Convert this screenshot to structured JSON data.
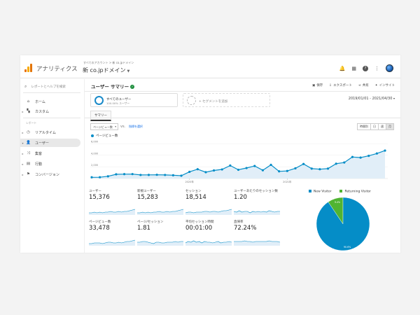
{
  "app": {
    "name": "アナリティクス"
  },
  "header": {
    "breadcrumb": "すべてのアカウント > 新 co.jpドメイン",
    "property": "新 co.jpドメイン",
    "icons": [
      "bell-icon",
      "apps-icon",
      "help-icon",
      "more-icon"
    ]
  },
  "sidebar": {
    "search_placeholder": "レポートとヘルプを検索",
    "items_top": [
      {
        "label": "ホーム",
        "icon": "home-icon"
      },
      {
        "label": "カスタム",
        "icon": "grid-icon"
      }
    ],
    "section_label": "レポート",
    "items": [
      {
        "label": "リアルタイム",
        "icon": "clock-icon",
        "active": false
      },
      {
        "label": "ユーザー",
        "icon": "person-icon",
        "active": true
      },
      {
        "label": "集客",
        "icon": "acquisition-icon",
        "active": false
      },
      {
        "label": "行動",
        "icon": "behavior-icon",
        "active": false
      },
      {
        "label": "コンバージョン",
        "icon": "flag-icon",
        "active": false
      }
    ]
  },
  "page": {
    "title": "ユーザー サマリー",
    "actions": {
      "save": "保存",
      "export": "エクスポート",
      "share": "共有",
      "insight": "インサイト"
    },
    "segments": {
      "all_users": "すべてのユーザー",
      "all_users_sub": "100.00% ユーザー",
      "add_segment": "+ セグメントを追加"
    },
    "date_range": "2019/01/01 - 2021/04/30",
    "tab": "サマリー",
    "metric_select": "ページビュー数",
    "vs": "vs.",
    "compare_label": "指標を選択",
    "period_buttons": [
      "時間別",
      "日",
      "週",
      "月"
    ],
    "period_selected": "月"
  },
  "chart_data": {
    "type": "line",
    "series": [
      {
        "name": "ページビュー数",
        "values": [
          210,
          220,
          380,
          720,
          750,
          760,
          610,
          620,
          640,
          610,
          560,
          480,
          1150,
          1600,
          1080,
          1380,
          1560,
          2230,
          1500,
          1800,
          2150,
          1420,
          2350,
          1230,
          1300,
          1750,
          2500,
          1700,
          1600,
          1700,
          2550,
          2750,
          3700,
          3600,
          3900,
          4300,
          4800
        ]
      }
    ],
    "x_labels": [
      "2020年",
      "2021年"
    ],
    "y_ticks": [
      "2,000",
      "4,000",
      "6,000"
    ],
    "ylim": [
      0,
      6500
    ],
    "color": "#058dc7",
    "fill": "#e1eef8"
  },
  "metrics": [
    {
      "label": "ユーザー",
      "value": "15,376",
      "spark": [
        3,
        3,
        4,
        3,
        4,
        3,
        4,
        4,
        5,
        4,
        4,
        5,
        4,
        5,
        5,
        6,
        7,
        8
      ]
    },
    {
      "label": "新規ユーザー",
      "value": "15,283",
      "spark": [
        3,
        3,
        4,
        3,
        4,
        3,
        4,
        4,
        5,
        4,
        4,
        5,
        4,
        5,
        5,
        6,
        7,
        8
      ]
    },
    {
      "label": "セッション",
      "value": "18,514",
      "spark": [
        3,
        4,
        4,
        3,
        4,
        4,
        4,
        5,
        5,
        4,
        5,
        5,
        4,
        5,
        6,
        6,
        7,
        8
      ]
    },
    {
      "label": "ユーザーあたりのセッション数",
      "value": "1.20",
      "spark": [
        5,
        4,
        6,
        4,
        5,
        5,
        3,
        5,
        4,
        5,
        4,
        5,
        4,
        6,
        5,
        4,
        5,
        5
      ]
    },
    {
      "label": "ページビュー数",
      "value": "33,478",
      "spark": [
        3,
        3,
        4,
        4,
        4,
        3,
        4,
        5,
        5,
        4,
        4,
        5,
        4,
        5,
        6,
        6,
        7,
        8
      ]
    },
    {
      "label": "ページ/セッション",
      "value": "1.81",
      "spark": [
        5,
        5,
        6,
        6,
        5,
        4,
        3,
        5,
        5,
        4,
        4,
        5,
        5,
        5,
        6,
        5,
        6,
        6
      ]
    },
    {
      "label": "平均セッション時間",
      "value": "00:01:00",
      "spark": [
        4,
        6,
        5,
        7,
        5,
        6,
        4,
        6,
        5,
        5,
        4,
        5,
        6,
        4,
        5,
        5,
        6,
        5
      ]
    },
    {
      "label": "直帰率",
      "value": "72.24%",
      "spark": [
        6,
        6,
        6,
        6,
        7,
        6,
        6,
        5,
        6,
        6,
        6,
        6,
        6,
        7,
        6,
        6,
        6,
        5
      ]
    }
  ],
  "pie_chart": {
    "type": "pie",
    "slices": [
      {
        "name": "New Visitor",
        "value": 90.6,
        "label": "90.6%",
        "color": "#058dc7"
      },
      {
        "name": "Returning Visitor",
        "value": 9.4,
        "label": "9.4%",
        "color": "#50b432"
      }
    ]
  }
}
